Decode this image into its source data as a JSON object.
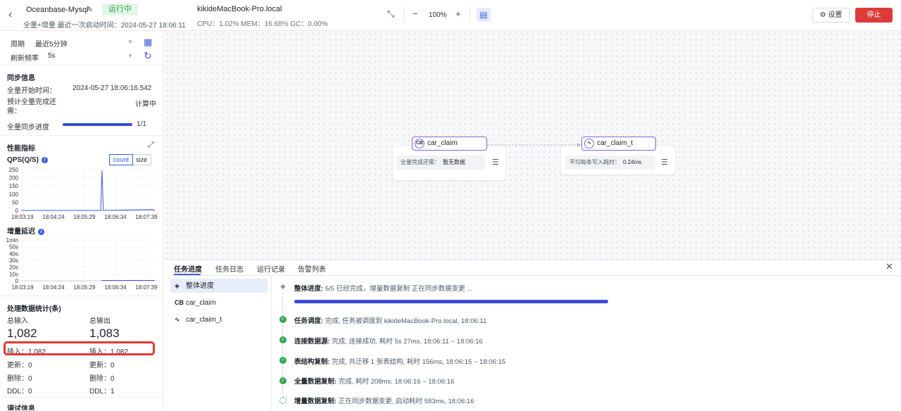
{
  "header": {
    "task_name": "Oceanbase-Mysql",
    "status": "运行中",
    "subtitle": "全量+增量  最近一次启动时间：2024-05-27 18:06:11",
    "host": "kikideMacBook-Pro.local",
    "stats": "CPU：1.02%   MEM：16.68%   GC：0.00%",
    "zoom": "100%",
    "settings_label": "设置",
    "stop_label": "停止"
  },
  "left": {
    "period_label": "周期",
    "period_value": "最近5分钟",
    "refresh_label": "刷新频率",
    "refresh_value": "5s",
    "sync_title": "同步信息",
    "full_start_label": "全量开始时间：",
    "full_start_value": "2024-05-27 18:06:16.542",
    "eta_label": "预计全量完成还需：",
    "eta_value": "计算中",
    "progress_label": "全量同步进度",
    "progress_value": "1/1",
    "progress_fraction": 1.0,
    "perf_title": "性能指标",
    "qps_label": "QPS(Q/S)",
    "count_label": "count",
    "size_label": "size",
    "delay_label": "增量延迟",
    "stats_title": "处理数据统计(条)",
    "total_in_label": "总输入",
    "total_out_label": "总输出",
    "total_in": "1,082",
    "total_out": "1,083",
    "in_rows": [
      "插入：1,082",
      "更新：0",
      "删除：0",
      "DDL：0"
    ],
    "out_rows": [
      "插入：1,082",
      "更新：0",
      "删除：0",
      "DDL：1"
    ],
    "debug_title": "调试信息"
  },
  "chart_data": [
    {
      "type": "line",
      "title": "QPS(Q/S)",
      "x": [
        "18:03:19",
        "18:04:24",
        "18:05:29",
        "18:06:34",
        "18:07:39"
      ],
      "yticks": [
        "250",
        "200",
        "150",
        "100",
        "50",
        "0"
      ],
      "ylim": [
        0,
        250
      ],
      "series": [
        {
          "points": [
            [
              0,
              0
            ],
            [
              0.595,
              0
            ],
            [
              0.605,
              245
            ],
            [
              0.615,
              0
            ],
            [
              0.98,
              5
            ],
            [
              1,
              0
            ]
          ]
        }
      ]
    },
    {
      "type": "line",
      "title": "增量延迟",
      "x": [
        "18:03:19",
        "18:04:24",
        "18:05:29",
        "18:06:34",
        "18:07:39"
      ],
      "yticks": [
        "1min",
        "50s",
        "40s",
        "30s",
        "20s",
        "10s",
        "0"
      ],
      "ylim": [
        0,
        60
      ],
      "series": [
        {
          "points": [
            [
              0.6,
              0.5
            ],
            [
              1,
              0.5
            ]
          ]
        }
      ]
    }
  ],
  "canvas": {
    "source_node": "car_claim",
    "source_icon": "CB",
    "source_metric_label": "全量完成还需：",
    "source_metric_value": "暂无数据",
    "target_node": "car_claim_t",
    "target_metric_label": "平均每条写入耗时：",
    "target_metric_value": "0.24ms"
  },
  "bottom": {
    "tabs": [
      "任务进度",
      "任务日志",
      "运行记录",
      "告警列表"
    ],
    "side_items": [
      "整体进度",
      "car_claim",
      "car_claim_t"
    ],
    "overall_label": "整体进度:",
    "overall_text": "5/5 已经完成，增量数据复制 正在同步数据变更 ...",
    "overall_fraction": 1.0,
    "steps": [
      {
        "title": "任务调度:",
        "text": "完成, 任务被调度到 kikideMacBook-Pro.local, 18:06:11"
      },
      {
        "title": "连接数据源:",
        "text": "完成, 连接成功, 耗时 5s 27ms, 18:06:11 ~ 18:06:16"
      },
      {
        "title": "表结构复制:",
        "text": "完成, 共迁移 1 张表结构, 耗时 156ms, 18:06:15 ~ 18:06:15"
      },
      {
        "title": "全量数据复制:",
        "text": "完成, 耗时 208ms, 18:06:16 ~ 18:06:16"
      },
      {
        "title": "增量数据复制:",
        "text": "正在同步数据变更, 启动耗时 583ms, 18:06:16"
      }
    ]
  }
}
